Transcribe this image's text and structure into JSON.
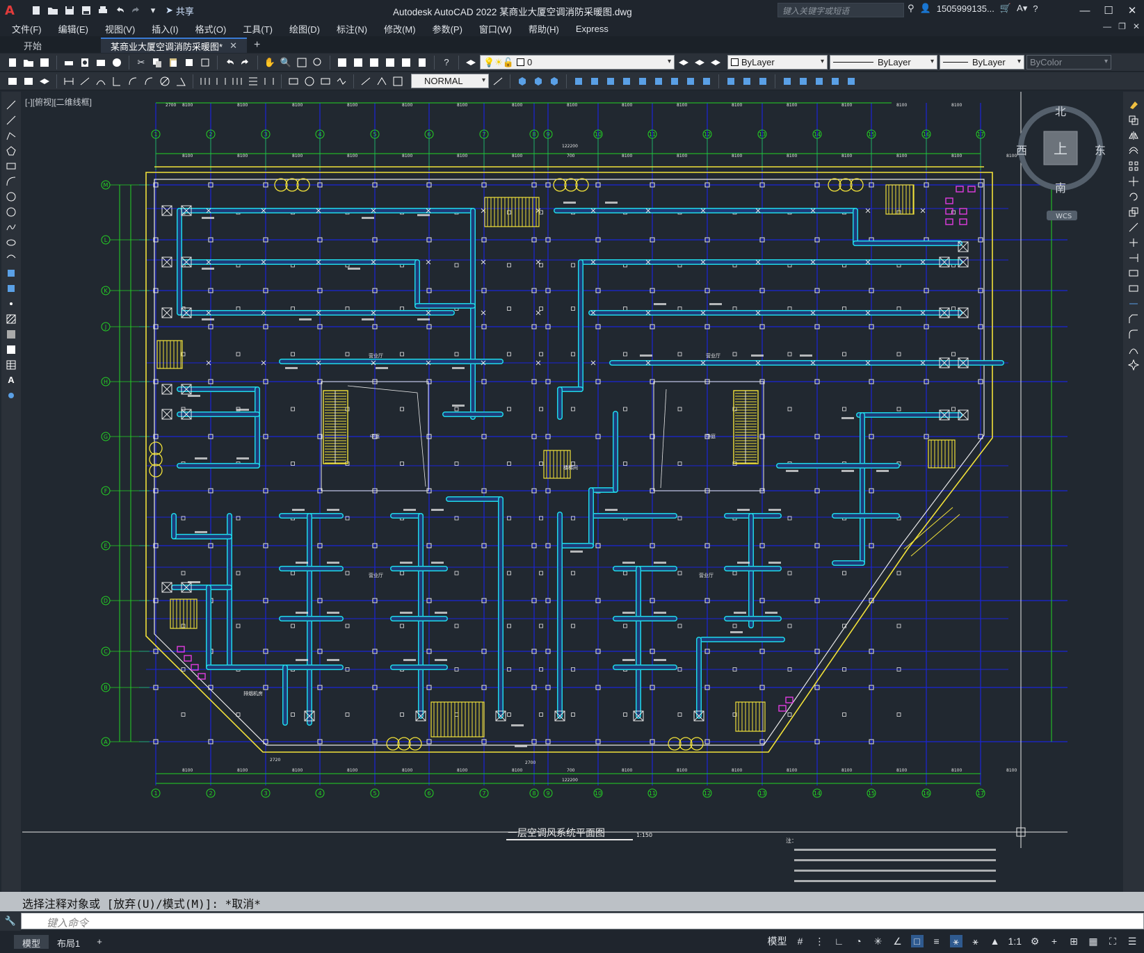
{
  "app": {
    "title": "Autodesk AutoCAD 2022    某商业大厦空调消防采暖图.dwg",
    "logo": "A",
    "share_label": "共享",
    "search_placeholder": "键入关键字或短语",
    "user": "1505999135...",
    "help": "?"
  },
  "menu": [
    "文件(F)",
    "编辑(E)",
    "视图(V)",
    "插入(I)",
    "格式(O)",
    "工具(T)",
    "绘图(D)",
    "标注(N)",
    "修改(M)",
    "参数(P)",
    "窗口(W)",
    "帮助(H)",
    "Express"
  ],
  "tabs": {
    "start": "开始",
    "drawing": "某商业大厦空调消防采暖图*",
    "add": "+"
  },
  "toolbar": {
    "layer_value": "0",
    "color_value": "ByLayer",
    "linetype_value": "ByLayer",
    "lineweight_value": "ByLayer",
    "plotstyle_value": "ByColor",
    "dimstyle_value": "NORMAL"
  },
  "viewport": {
    "label": "[-][俯视][二维线框]"
  },
  "viewcube": {
    "north": "北",
    "south": "南",
    "east": "东",
    "west": "西",
    "face": "上",
    "wcs": "WCS"
  },
  "drawing": {
    "title": "一层空调风系统平面图",
    "scale": "1:150",
    "notes_head": "注：",
    "col_labels": [
      "1",
      "2",
      "3",
      "4",
      "5",
      "6",
      "7",
      "8",
      "9",
      "10",
      "11",
      "12",
      "13",
      "14",
      "15",
      "16",
      "17"
    ],
    "row_labels": [
      "M",
      "L",
      "K",
      "J",
      "H",
      "G",
      "F",
      "E",
      "D",
      "C",
      "B",
      "A"
    ],
    "dim_top": [
      "2700",
      "8100",
      "8100",
      "8100",
      "8100",
      "8100",
      "8100",
      "8100",
      "8100",
      "8100",
      "8100",
      "8100",
      "8100",
      "8100",
      "8100",
      "8100"
    ],
    "dim_top2": [
      "8100",
      "8100",
      "8100",
      "8100",
      "8100",
      "8100",
      "8100",
      "700",
      "8100",
      "8100",
      "8100",
      "8100",
      "8100",
      "8100",
      "8100",
      "8100"
    ],
    "total_width": "122200",
    "room_labels": [
      "营业厅",
      "营业厅",
      "营业厅",
      "营业厅",
      "中庭",
      "中庭",
      "楼梯间",
      "排烟机房"
    ],
    "bottom_dims": [
      "2720",
      "2700"
    ]
  },
  "command": {
    "history": "选择注释对象或 [放弃(U)/模式(M)]: *取消*",
    "placeholder": "键入命令"
  },
  "status": {
    "tabs": [
      "模型",
      "布局1",
      "+"
    ],
    "model_label": "模型",
    "scale": "1:1"
  },
  "colors": {
    "canvas_bg": "#212830",
    "duct_cyan": "#1fd8e6",
    "grid_blue": "#1b24d8",
    "axis_green": "#24d424",
    "wall_white": "#e8e8e8",
    "yellow": "#f2e23a",
    "magenta": "#e23ce2"
  }
}
